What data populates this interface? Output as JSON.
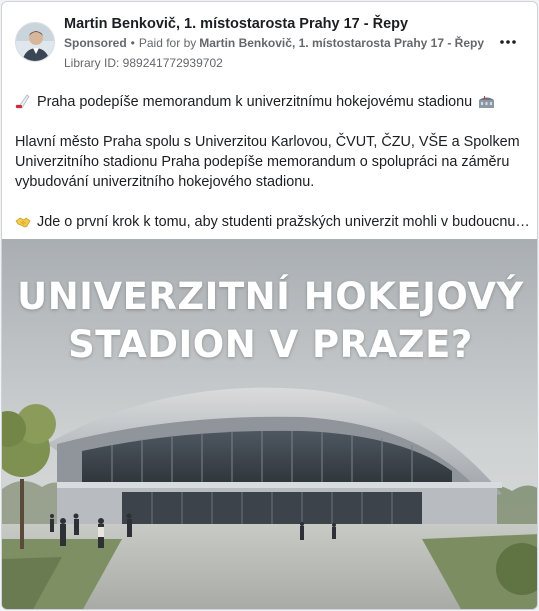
{
  "post": {
    "page_name": "Martin Benkovič, 1. místostarosta Prahy 17 - Řepy",
    "sponsored_label": "Sponsored",
    "paid_for_prefix": "Paid for by",
    "paid_for_name": "Martin Benkovič, 1. místostarosta Prahy 17 - Řepy",
    "library_id": "Library ID: 989241772939702",
    "more_icon": "more-horizontal-icon"
  },
  "text": {
    "line1": "Praha podepíše memorandum k univerzitnímu hokejovému stadionu",
    "para2_l1": "Hlavní město Praha spolu s Univerzitou Karlovou, ČVUT, ČZU, VŠE a Spolkem",
    "para2_l2": "Univerzitního stadionu Praha podepíše memorandum o spolupráci na záměru",
    "para2_l3": "vybudování univerzitního hokejového stadionu.",
    "para3": "Jde o první krok k tomu, aby studenti pražských univerzit mohli v budoucnu…"
  },
  "image": {
    "headline_line1": "UNIVERZITNÍ HOKEJOVÝ",
    "headline_line2": "STADION V PRAZE?"
  },
  "colors": {
    "secondary_text": "#65676b",
    "primary_text": "#1c1e21",
    "card_border": "#cfd3d8"
  }
}
